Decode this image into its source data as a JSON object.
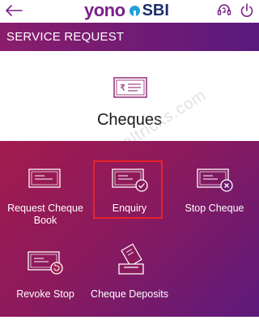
{
  "topbar": {
    "brand_left": "yono",
    "brand_right": "SBI",
    "back_icon": "arrow-left-icon",
    "help_icon": "headset-icon",
    "logout_icon": "power-icon"
  },
  "header": {
    "title": "SERVICE REQUEST"
  },
  "hero": {
    "icon": "cheque-rupee-icon",
    "title": "Cheques"
  },
  "watermark": "@sbidigitaltricks.com",
  "options": [
    {
      "label": "Request Cheque Book",
      "icon": "cheque-book-icon"
    },
    {
      "label": "Enquiry",
      "icon": "cheque-check-icon",
      "highlighted": true
    },
    {
      "label": "Stop Cheque",
      "icon": "cheque-cancel-icon"
    },
    {
      "label": "Revoke Stop",
      "icon": "cheque-revoke-icon"
    },
    {
      "label": "Cheque Deposits",
      "icon": "cheque-deposit-icon"
    }
  ],
  "colors": {
    "header_gradient": [
      "#8a1d6b",
      "#5a1a7e"
    ],
    "panel_gradient": [
      "#a21b4e",
      "#5c1a7c"
    ],
    "highlight_border": "#e8232a",
    "brand_purple": "#7a1f8a",
    "brand_blue": "#1c2f6b"
  }
}
